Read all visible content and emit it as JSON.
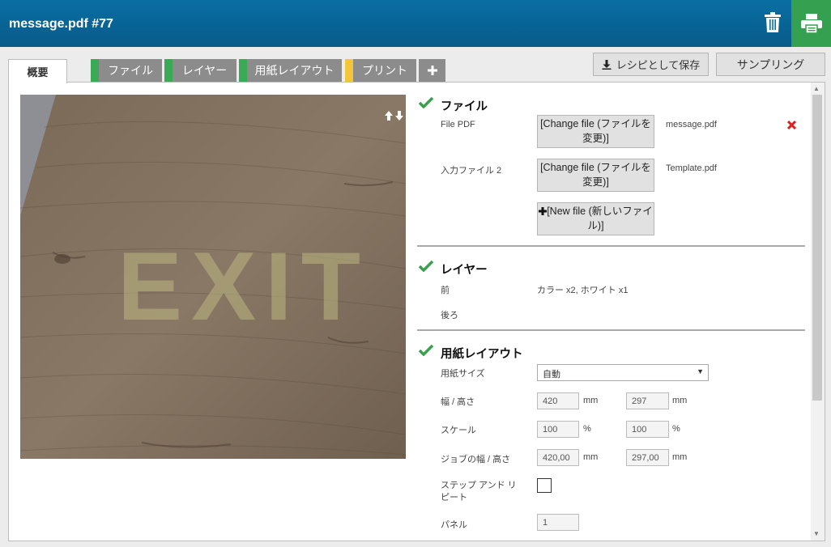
{
  "header": {
    "title": "message.pdf #77"
  },
  "tabs": [
    {
      "label": "概要",
      "active": true
    },
    {
      "label": "ファイル",
      "stripe": "#3aaa55"
    },
    {
      "label": "レイヤー",
      "stripe": "#3aaa55"
    },
    {
      "label": "用紙レイアウト",
      "stripe": "#3aaa55"
    },
    {
      "label": "プリント",
      "stripe": "#f2c53d"
    }
  ],
  "actions": {
    "save_recipe": "レシピとして保存",
    "sampling": "サンプリング"
  },
  "preview": {
    "image_text": "EXIT"
  },
  "file_section": {
    "title": "ファイル",
    "rows": [
      {
        "label": "File PDF",
        "button": "[Change file (ファイルを変更)]",
        "filename": "message.pdf"
      },
      {
        "label": "入力ファイル 2",
        "button": "[Change file (ファイルを変更)]",
        "filename": "Template.pdf"
      }
    ],
    "new_file_button": "[New file (新しいファイル)]"
  },
  "layer_section": {
    "title": "レイヤー",
    "front_label": "前",
    "front_value": "カラー x2, ホワイト x1",
    "back_label": "後ろ"
  },
  "paper_section": {
    "title": "用紙レイアウト",
    "paper_size_label": "用紙サイズ",
    "paper_size_value": "自動",
    "wh_label": "幅 / 高さ",
    "width": "420",
    "height": "297",
    "scale_label": "スケール",
    "scale_x": "100",
    "scale_y": "100",
    "job_wh_label": "ジョブの幅 / 高さ",
    "job_width": "420,00",
    "job_height": "297,00",
    "step_repeat_label": "ステップ アンド リピート",
    "panel_label": "パネル",
    "panel_value": "1",
    "unit_mm": "mm",
    "unit_pct": "%"
  },
  "colors": {
    "header": "#0a6fa4",
    "print_button": "#35a050",
    "check": "#3aa04e",
    "delete": "#e02020"
  }
}
